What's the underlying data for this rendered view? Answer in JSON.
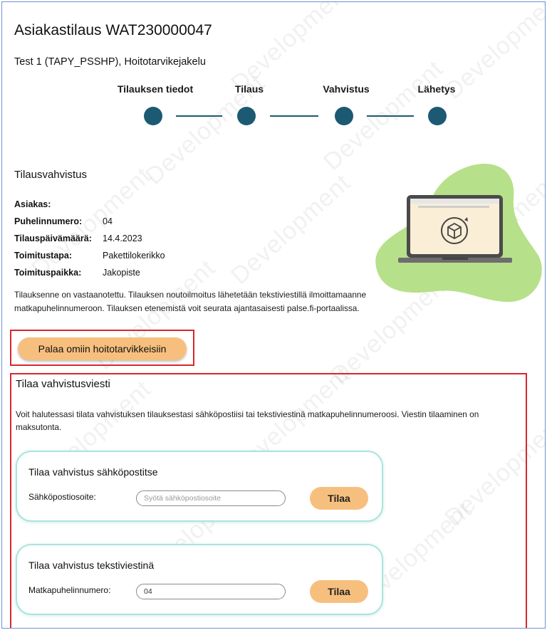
{
  "watermark": "Development",
  "page_title": "Asiakastilaus WAT230000047",
  "subtitle": "Test 1 (TAPY_PSSHP), Hoitotarvikejakelu",
  "stepper": {
    "steps": [
      "Tilauksen tiedot",
      "Tilaus",
      "Vahvistus",
      "Lähetys"
    ],
    "color": "#1b5a72"
  },
  "confirmation": {
    "title": "Tilausvahvistus",
    "fields": [
      {
        "label": "Asiakas:",
        "value": ""
      },
      {
        "label": "Puhelinnumero:",
        "value": "04"
      },
      {
        "label": "Tilauspäivämäärä:",
        "value": "14.4.2023"
      },
      {
        "label": "Toimitustapa:",
        "value": "Pakettilokerikko"
      },
      {
        "label": "Toimituspaikka:",
        "value": "Jakopiste"
      }
    ],
    "notice": "Tilauksenne on vastaanotettu. Tilauksen noutoilmoitus lähetetään tekstiviestillä ilmoittamaanne matkapuhelinnumeroon. Tilauksen etenemistä voit seurata ajantasaisesti palse.fi-portaalissa.",
    "return_button": "Palaa omiin hoitotarvikkeisiin"
  },
  "order_message": {
    "title": "Tilaa vahvistusviesti",
    "description": "Voit halutessasi tilata vahvistuksen tilauksestasi sähköpostiisi tai tekstiviestinä matkapuhelinnumeroosi. Viestin tilaaminen on maksutonta.",
    "email_card": {
      "title": "Tilaa vahvistus sähköpostitse",
      "label": "Sähköpostiosoite:",
      "placeholder": "Syötä sähköpostiosoite",
      "value": "",
      "button": "Tilaa"
    },
    "sms_card": {
      "title": "Tilaa vahvistus tekstiviestinä",
      "label": "Matkapuhelinnumero:",
      "value": "04",
      "button": "Tilaa"
    }
  },
  "colors": {
    "accent_button": "#f7bf7e",
    "highlight_border": "#d9262e",
    "card_border": "#a9e4dc",
    "blob": "#b7e08a"
  },
  "icons": {
    "illustration": "laptop-with-package-icon"
  }
}
